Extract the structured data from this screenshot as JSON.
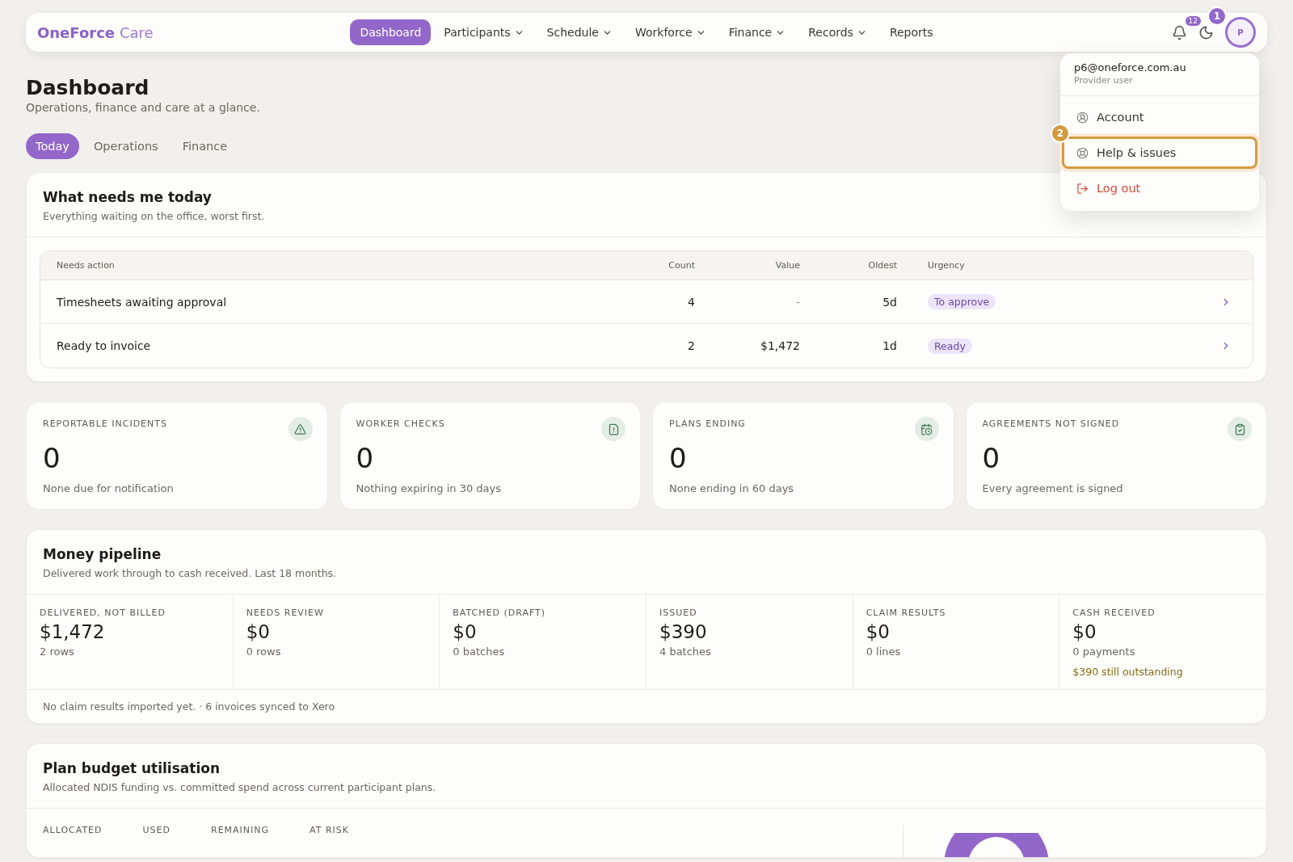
{
  "brand": {
    "name": "OneForce",
    "suffix": "Care"
  },
  "nav": [
    {
      "label": "Dashboard",
      "selected": true,
      "dropdown": false
    },
    {
      "label": "Participants",
      "selected": false,
      "dropdown": true
    },
    {
      "label": "Schedule",
      "selected": false,
      "dropdown": true
    },
    {
      "label": "Workforce",
      "selected": false,
      "dropdown": true
    },
    {
      "label": "Finance",
      "selected": false,
      "dropdown": true
    },
    {
      "label": "Records",
      "selected": false,
      "dropdown": true
    },
    {
      "label": "Reports",
      "selected": false,
      "dropdown": false
    }
  ],
  "notifications": {
    "count": "12"
  },
  "avatar": {
    "initial": "P",
    "callout": "1"
  },
  "user_menu": {
    "email": "p6@oneforce.com.au",
    "role": "Provider user",
    "items": [
      {
        "label": "Account",
        "kind": "account",
        "selected": false,
        "danger": false
      },
      {
        "label": "Help & issues",
        "kind": "help",
        "selected": true,
        "danger": false,
        "callout": "2"
      },
      {
        "label": "Log out",
        "kind": "logout",
        "selected": false,
        "danger": true
      }
    ]
  },
  "page": {
    "title": "Dashboard",
    "subtitle": "Operations, finance and care at a glance."
  },
  "tabs": [
    {
      "label": "Today",
      "selected": true
    },
    {
      "label": "Operations",
      "selected": false
    },
    {
      "label": "Finance",
      "selected": false
    }
  ],
  "needs": {
    "title": "What needs me today",
    "subtitle": "Everything waiting on the office, worst first.",
    "columns": [
      "Needs action",
      "Count",
      "Value",
      "Oldest",
      "Urgency"
    ],
    "rows": [
      {
        "action": "Timesheets awaiting approval",
        "count": "4",
        "value": "-",
        "oldest": "5d",
        "urgency": "To approve"
      },
      {
        "action": "Ready to invoice",
        "count": "2",
        "value": "$1,472",
        "oldest": "1d",
        "urgency": "Ready"
      }
    ]
  },
  "stats": [
    {
      "label": "REPORTABLE INCIDENTS",
      "value": "0",
      "note": "None due for notification",
      "kind": "warning"
    },
    {
      "label": "WORKER CHECKS",
      "value": "0",
      "note": "Nothing expiring in 30 days",
      "kind": "alert"
    },
    {
      "label": "PLANS ENDING",
      "value": "0",
      "note": "None ending in 60 days",
      "kind": "calendar"
    },
    {
      "label": "AGREEMENTS NOT SIGNED",
      "value": "0",
      "note": "Every agreement is signed",
      "kind": "clipboard"
    }
  ],
  "pipeline": {
    "title": "Money pipeline",
    "subtitle": "Delivered work through to cash received. Last 18 months.",
    "stages": [
      {
        "label": "DELIVERED, NOT BILLED",
        "value": "$1,472",
        "note": "2 rows"
      },
      {
        "label": "NEEDS REVIEW",
        "value": "$0",
        "note": "0 rows"
      },
      {
        "label": "BATCHED (DRAFT)",
        "value": "$0",
        "note": "0 batches"
      },
      {
        "label": "ISSUED",
        "value": "$390",
        "note": "4 batches"
      },
      {
        "label": "CLAIM RESULTS",
        "value": "$0",
        "note": "0 lines"
      },
      {
        "label": "CASH RECEIVED",
        "value": "$0",
        "note": "0 payments",
        "warning": "$390 still outstanding"
      }
    ],
    "footer": "No claim results imported yet. · 6 invoices synced to Xero"
  },
  "budget": {
    "title": "Plan budget utilisation",
    "subtitle": "Allocated NDIS funding vs. committed spend across current participant plans.",
    "stats": [
      "ALLOCATED",
      "USED",
      "REMAINING",
      "AT RISK"
    ]
  }
}
